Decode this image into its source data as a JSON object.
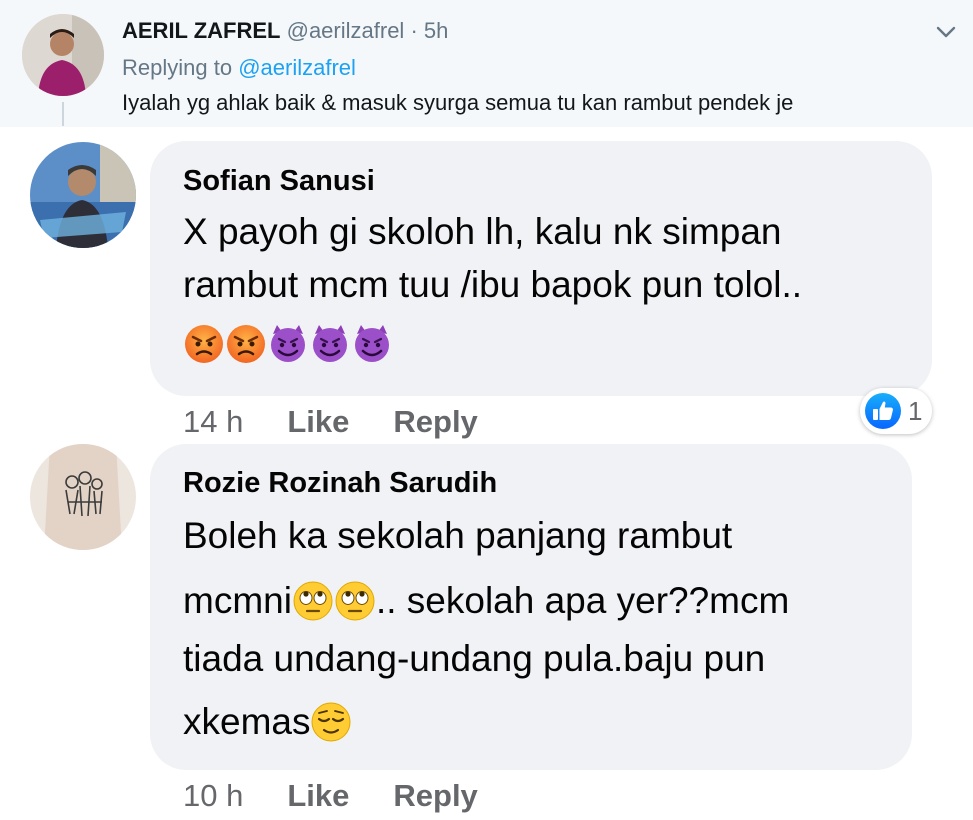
{
  "tweet": {
    "display_name": "AERIL ZAFREL",
    "handle": "@aerilzafrel",
    "separator": "·",
    "time": "5h",
    "replying_prefix": "Replying to",
    "replying_to": "@aerilzafrel",
    "text": "Iyalah yg ahlak baik & masuk syurga semua tu kan rambut pendek je"
  },
  "comments": [
    {
      "name": "Sofian Sanusi",
      "lines": [
        "X payoh gi skoloh lh, kalu nk simpan",
        "rambut mcm tuu /ibu bapok pun tolol.."
      ],
      "emojis": [
        "angry-face",
        "angry-face",
        "smiling-devil",
        "smiling-devil",
        "smiling-devil"
      ],
      "time": "14 h",
      "like_label": "Like",
      "reply_label": "Reply",
      "reaction_count": "1"
    },
    {
      "name": "Rozie Rozinah Sarudih",
      "line1": "Boleh ka sekolah panjang rambut",
      "line2_pre": "mcmni",
      "line2_post": ".. sekolah apa yer??mcm",
      "line3": "tiada undang-undang pula.baju pun",
      "line4": "xkemas",
      "time": "10 h",
      "like_label": "Like",
      "reply_label": "Reply"
    }
  ],
  "colors": {
    "tweet_bg": "#f5f8fa",
    "link_blue": "#1da1f2",
    "bubble_bg": "#f0f2f5",
    "fb_blue": "#1877f2",
    "meta_gray": "#65676b"
  }
}
